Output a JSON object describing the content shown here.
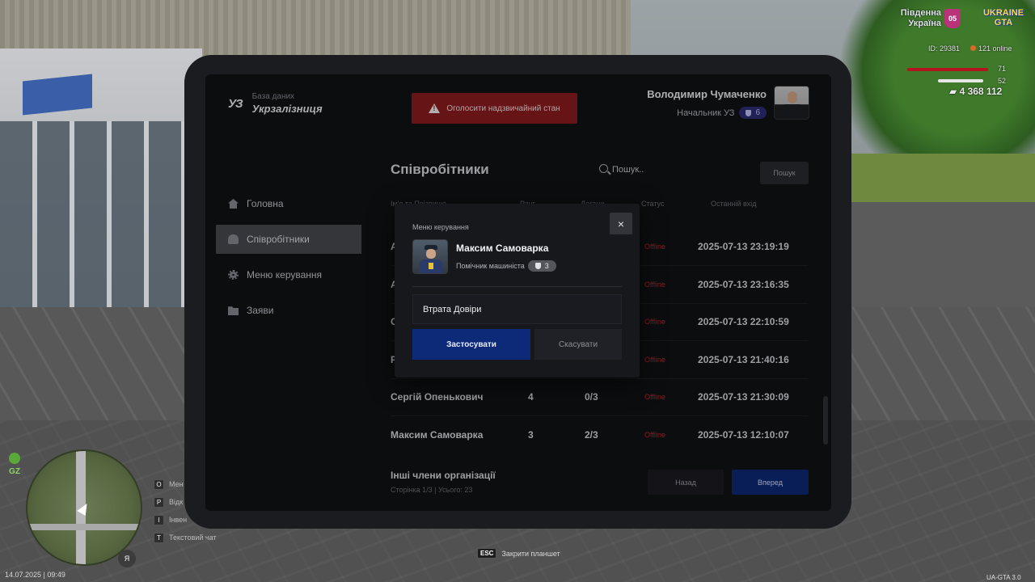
{
  "hud": {
    "region_line1": "Південна",
    "region_line2": "Україна",
    "region_badge": "05",
    "game_logo_line1": "UKRAINE",
    "game_logo_line2": "GTA",
    "player_id": "ID: 29381",
    "online": "121 online",
    "health": "71",
    "armor": "52",
    "money": "4 368 112",
    "zone": "GZ",
    "compass": "Я",
    "keys": [
      {
        "key": "O",
        "label": "Мен"
      },
      {
        "key": "P",
        "label": "Відк"
      },
      {
        "key": "I",
        "label": "Інвен"
      },
      {
        "key": "T",
        "label": "Текстовий чат"
      }
    ],
    "esc_key": "ESC",
    "esc_label": "Закрити планшет",
    "date": "14.07.2025 | 09:49",
    "version": "UA-GTA 3.0",
    "fps": "45"
  },
  "tablet": {
    "logo": "УЗ",
    "brand_sub": "База даних",
    "brand_title": "Укрзалізниця",
    "emergency_button": "Оголосити надзвичайний стан",
    "user": {
      "name": "Володимир Чумаченко",
      "role": "Начальник УЗ",
      "rank": "6"
    },
    "nav": [
      {
        "label": "Головна",
        "icon": "home-icon"
      },
      {
        "label": "Співробітники",
        "icon": "users-icon",
        "active": true
      },
      {
        "label": "Меню керування",
        "icon": "gear-icon"
      },
      {
        "label": "Заяви",
        "icon": "folder-icon"
      }
    ],
    "main_title": "Співробітники",
    "search_placeholder": "Пошук..",
    "search_button": "Пошук",
    "table_headers": [
      "Ім'я та Прізвище",
      "Ранг",
      "Догани",
      "Статус",
      "Останній вхід"
    ],
    "rows": [
      {
        "name": "А",
        "rank": "",
        "warnings": "",
        "status": "Offline",
        "last_login": "2025-07-13 23:19:19"
      },
      {
        "name": "А",
        "rank": "",
        "warnings": "",
        "status": "Offline",
        "last_login": "2025-07-13 23:16:35"
      },
      {
        "name": "С",
        "rank": "",
        "warnings": "",
        "status": "Offline",
        "last_login": "2025-07-13 22:10:59"
      },
      {
        "name": "Р",
        "rank": "",
        "warnings": "",
        "status": "Offline",
        "last_login": "2025-07-13 21:40:16"
      },
      {
        "name": "Сергій Опенькович",
        "rank": "4",
        "warnings": "0/3",
        "status": "Offline",
        "last_login": "2025-07-13 21:30:09"
      },
      {
        "name": "Максим Самоварка",
        "rank": "3",
        "warnings": "2/3",
        "status": "Offline",
        "last_login": "2025-07-13 12:10:07"
      }
    ],
    "others_title": "Інші члени організації",
    "page_info": "Сторінка 1/3 | Усього: 23",
    "prev_button": "Назад",
    "next_button": "Вперед"
  },
  "modal": {
    "title": "Меню керування",
    "close": "×",
    "employee_name": "Максим Самоварка",
    "employee_role": "Помічник машиніста",
    "employee_rank": "3",
    "input_value": "Втрата Довіри",
    "apply_button": "Застосувати",
    "cancel_button": "Скасувати"
  }
}
